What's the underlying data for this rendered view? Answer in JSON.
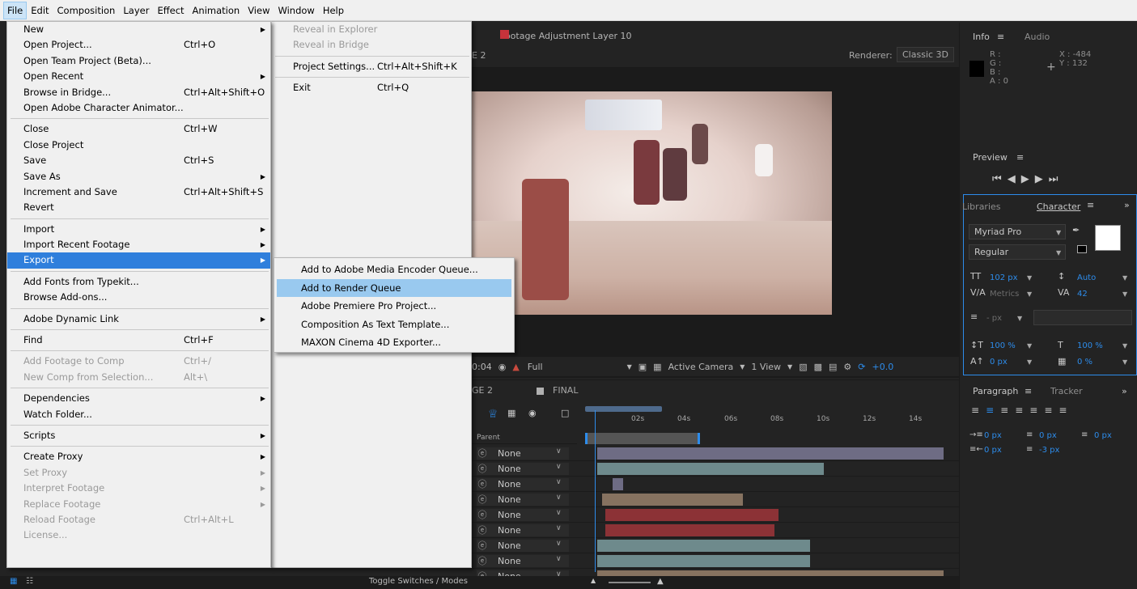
{
  "menubar": {
    "items": [
      "File",
      "Edit",
      "Composition",
      "Layer",
      "Effect",
      "Animation",
      "View",
      "Window",
      "Help"
    ]
  },
  "file_menu": {
    "items": [
      {
        "label": "New",
        "shortcut": "",
        "submenu": true
      },
      {
        "label": "Open Project...",
        "shortcut": "Ctrl+O"
      },
      {
        "label": "Open Team Project (Beta)...",
        "shortcut": ""
      },
      {
        "label": "Open Recent",
        "shortcut": "",
        "submenu": true
      },
      {
        "label": "Browse in Bridge...",
        "shortcut": "Ctrl+Alt+Shift+O"
      },
      {
        "label": "Open Adobe Character Animator...",
        "shortcut": ""
      },
      {
        "label": "Close",
        "shortcut": "Ctrl+W"
      },
      {
        "label": "Close Project",
        "shortcut": ""
      },
      {
        "label": "Save",
        "shortcut": "Ctrl+S"
      },
      {
        "label": "Save As",
        "shortcut": "",
        "submenu": true
      },
      {
        "label": "Increment and Save",
        "shortcut": "Ctrl+Alt+Shift+S"
      },
      {
        "label": "Revert",
        "shortcut": ""
      },
      {
        "label": "Import",
        "shortcut": "",
        "submenu": true
      },
      {
        "label": "Import Recent Footage",
        "shortcut": "",
        "submenu": true
      },
      {
        "label": "Export",
        "shortcut": "",
        "submenu": true
      },
      {
        "label": "Add Fonts from Typekit...",
        "shortcut": ""
      },
      {
        "label": "Browse Add-ons...",
        "shortcut": ""
      },
      {
        "label": "Adobe Dynamic Link",
        "shortcut": "",
        "submenu": true
      },
      {
        "label": "Find",
        "shortcut": "Ctrl+F"
      },
      {
        "label": "Add Footage to Comp",
        "shortcut": "Ctrl+/"
      },
      {
        "label": "New Comp from Selection...",
        "shortcut": "Alt+\\"
      },
      {
        "label": "Dependencies",
        "shortcut": "",
        "submenu": true
      },
      {
        "label": "Watch Folder...",
        "shortcut": ""
      },
      {
        "label": "Scripts",
        "shortcut": "",
        "submenu": true
      },
      {
        "label": "Create Proxy",
        "shortcut": "",
        "submenu": true
      },
      {
        "label": "Set Proxy",
        "shortcut": "",
        "submenu": true
      },
      {
        "label": "Interpret Footage",
        "shortcut": "",
        "submenu": true
      },
      {
        "label": "Replace Footage",
        "shortcut": "",
        "submenu": true
      },
      {
        "label": "Reload Footage",
        "shortcut": "Ctrl+Alt+L"
      },
      {
        "label": "License...",
        "shortcut": ""
      }
    ],
    "col2": [
      {
        "label": "Reveal in Explorer",
        "shortcut": ""
      },
      {
        "label": "Reveal in Bridge",
        "shortcut": ""
      },
      {
        "label": "Project Settings...",
        "shortcut": "Ctrl+Alt+Shift+K"
      },
      {
        "label": "Exit",
        "shortcut": "Ctrl+Q"
      }
    ]
  },
  "export_submenu": {
    "items": [
      "Add to Adobe Media Encoder Queue...",
      "Add to Render Queue",
      "Adobe Premiere Pro Project...",
      "Composition As Text Template...",
      "MAXON Cinema 4D Exporter..."
    ]
  },
  "composition": {
    "title": "Footage Adjustment Layer 10",
    "tab": "E 2",
    "renderer_label": "Renderer:",
    "renderer_value": "Classic 3D",
    "title_color": "#c7333b"
  },
  "viewer_toolbar": {
    "timecode": "0:04",
    "resolution": "Full",
    "camera": "Active Camera",
    "views": "1 View",
    "exposure": "+0.0"
  },
  "timeline": {
    "tabs": [
      "GE 2",
      "FINAL"
    ],
    "ruler_labels": [
      "02s",
      "04s",
      "06s",
      "08s",
      "10s",
      "12s",
      "14s"
    ],
    "parent_header": "Parent",
    "parent_value": "None",
    "toggle_label": "Toggle Switches / Modes",
    "rows": [
      {
        "color": "#6e6c84",
        "start": 0.015,
        "end": 1.0
      },
      {
        "color": "#6e8a8c",
        "start": 0.015,
        "end": 0.66
      },
      {
        "color": "#6e6c84",
        "start": 0.06,
        "end": 0.09
      },
      {
        "color": "#867260",
        "start": 0.03,
        "end": 0.43
      },
      {
        "color": "#8c3236",
        "start": 0.04,
        "end": 0.53
      },
      {
        "color": "#8c3236",
        "start": 0.04,
        "end": 0.52
      },
      {
        "color": "#6e8a8c",
        "start": 0.015,
        "end": 0.62
      },
      {
        "color": "#6e8a8c",
        "start": 0.015,
        "end": 0.62
      },
      {
        "color": "#867260",
        "start": 0.015,
        "end": 1.0
      }
    ]
  },
  "info_panel": {
    "tab_info": "Info",
    "tab_audio": "Audio",
    "r": "R :",
    "g": "G :",
    "b": "B :",
    "a": "A : 0",
    "x": "X : -484",
    "y": "Y : 132"
  },
  "preview_panel": {
    "title": "Preview"
  },
  "character_panel": {
    "tab_libraries": "Libraries",
    "tab_character": "Character",
    "font": "Myriad Pro",
    "style": "Regular",
    "size": "102 px",
    "leading": "Auto",
    "kerning": "Metrics",
    "tracking": "42",
    "stroke_width": "- px",
    "vscale": "100 %",
    "hscale": "100 %",
    "baseline": "0 px",
    "tsume": "0 %"
  },
  "paragraph_panel": {
    "tab_paragraph": "Paragraph",
    "tab_tracker": "Tracker",
    "indent_left": "0 px",
    "space_before": "0 px",
    "indent_right": "0 px",
    "first_line": "0 px",
    "space_after": "-3 px"
  },
  "colors": {
    "accent": "#2d8ceb",
    "menu_bg": "#f0f0f0",
    "menu_highlight": "#2f7fdc",
    "submenu_highlight": "#99c9ef",
    "panel_bg": "#232323"
  }
}
